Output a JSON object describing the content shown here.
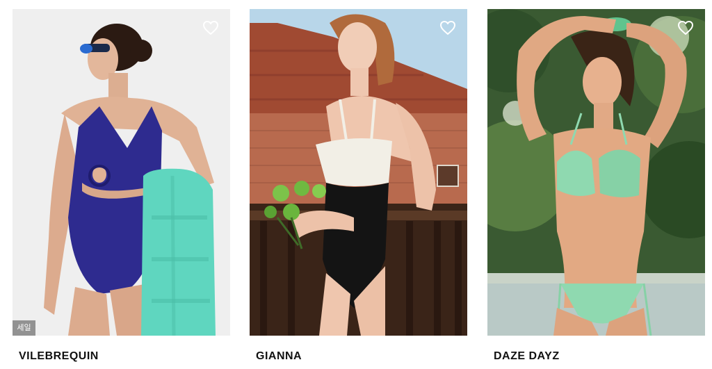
{
  "products": [
    {
      "brand": "VILEBREQUIN",
      "badge": "세일",
      "wishlist_icon": "heart-outline-icon",
      "colors": {
        "swimsuit": "#2e2b8f",
        "towel": "#5fd6bf",
        "background": "#f1f1f1"
      }
    },
    {
      "brand": "GIANNA",
      "badge": "",
      "wishlist_icon": "heart-outline-icon",
      "colors": {
        "swimsuit_top": "#f2efe6",
        "swimsuit_bottom": "#141414",
        "roof": "#a04a32",
        "sky": "#b8d6e9"
      }
    },
    {
      "brand": "DAZE DAYZ",
      "badge": "",
      "wishlist_icon": "heart-outline-icon",
      "colors": {
        "bikini": "#8fd9b0",
        "foliage": "#2f4f2a"
      }
    }
  ]
}
